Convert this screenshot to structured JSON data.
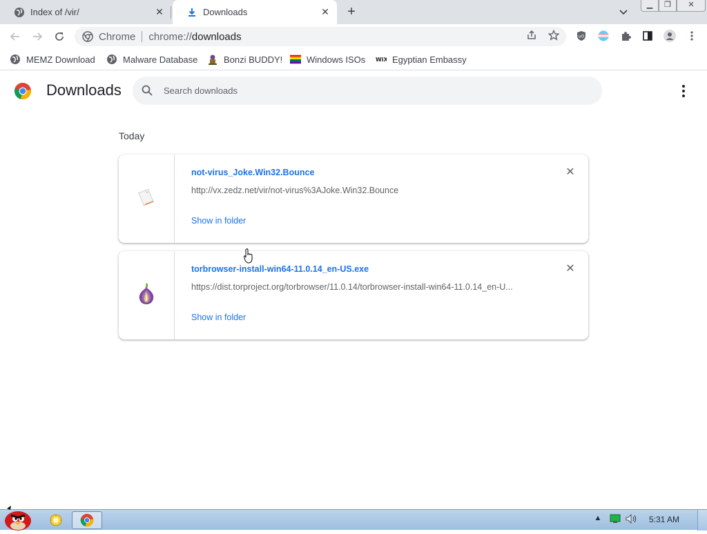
{
  "tabs": [
    {
      "title": "Index of /vir/",
      "icon": "globe-icon"
    },
    {
      "title": "Downloads",
      "icon": "download-icon",
      "active": true
    }
  ],
  "new_tab_glyph": "+",
  "toolbar": {
    "site_chip": "Chrome",
    "url_scheme": "chrome://",
    "url_host": "downloads"
  },
  "bookmarks": [
    {
      "label": "MEMZ Download",
      "icon": "globe-icon"
    },
    {
      "label": "Malware Database",
      "icon": "globe-icon"
    },
    {
      "label": "Bonzi BUDDY!",
      "icon": "bonzi-icon"
    },
    {
      "label": "Windows ISOs",
      "icon": "rainbow-flag-icon"
    },
    {
      "label": "Egyptian Embassy",
      "icon": "wix-icon"
    }
  ],
  "page": {
    "title": "Downloads",
    "search_placeholder": "Search downloads",
    "section_date": "Today"
  },
  "downloads": [
    {
      "filename": "not-virus_Joke.Win32.Bounce",
      "url": "http://vx.zedz.net/vir/not-virus%3AJoke.Win32.Bounce",
      "action": "Show in folder",
      "icon": "blank-file-icon"
    },
    {
      "filename": "torbrowser-install-win64-11.0.14_en-US.exe",
      "url": "https://dist.torproject.org/torbrowser/11.0.14/torbrowser-install-win64-11.0.14_en-U...",
      "action": "Show in folder",
      "icon": "tor-onion-icon"
    }
  ],
  "taskbar": {
    "clock": "5:31 AM"
  },
  "colors": {
    "accent": "#1a73e8",
    "tabstrip": "#dee1e6",
    "taskbar": "#bcd3ea"
  }
}
